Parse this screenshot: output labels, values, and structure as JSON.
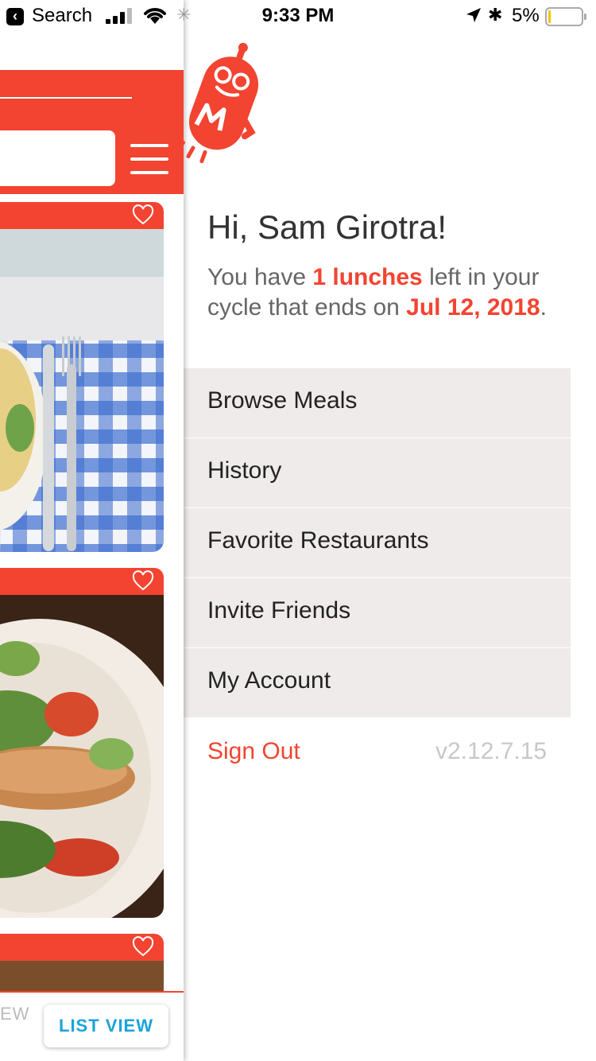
{
  "status_bar": {
    "back_app": "Search",
    "time": "9:33 PM",
    "battery": "5%"
  },
  "background_app": {
    "bottom_tabs": {
      "left_partial": "EW",
      "list_view": "LIST VIEW"
    }
  },
  "drawer": {
    "greeting": "Hi, Sam Girotra!",
    "summary": {
      "pre": "You have ",
      "lunches": "1 lunches",
      "mid": " left in your cycle that ends on ",
      "date": "Jul 12, 2018",
      "post": "."
    },
    "menu": [
      {
        "label": "Browse Meals"
      },
      {
        "label": "History"
      },
      {
        "label": "Favorite Restaurants"
      },
      {
        "label": "Invite Friends"
      },
      {
        "label": "My Account"
      }
    ],
    "sign_out": "Sign Out",
    "version": "v2.12.7.15"
  },
  "colors": {
    "brand_red": "#f24431",
    "menu_bg": "#eeebea",
    "accent_blue": "#1aa3d9"
  }
}
